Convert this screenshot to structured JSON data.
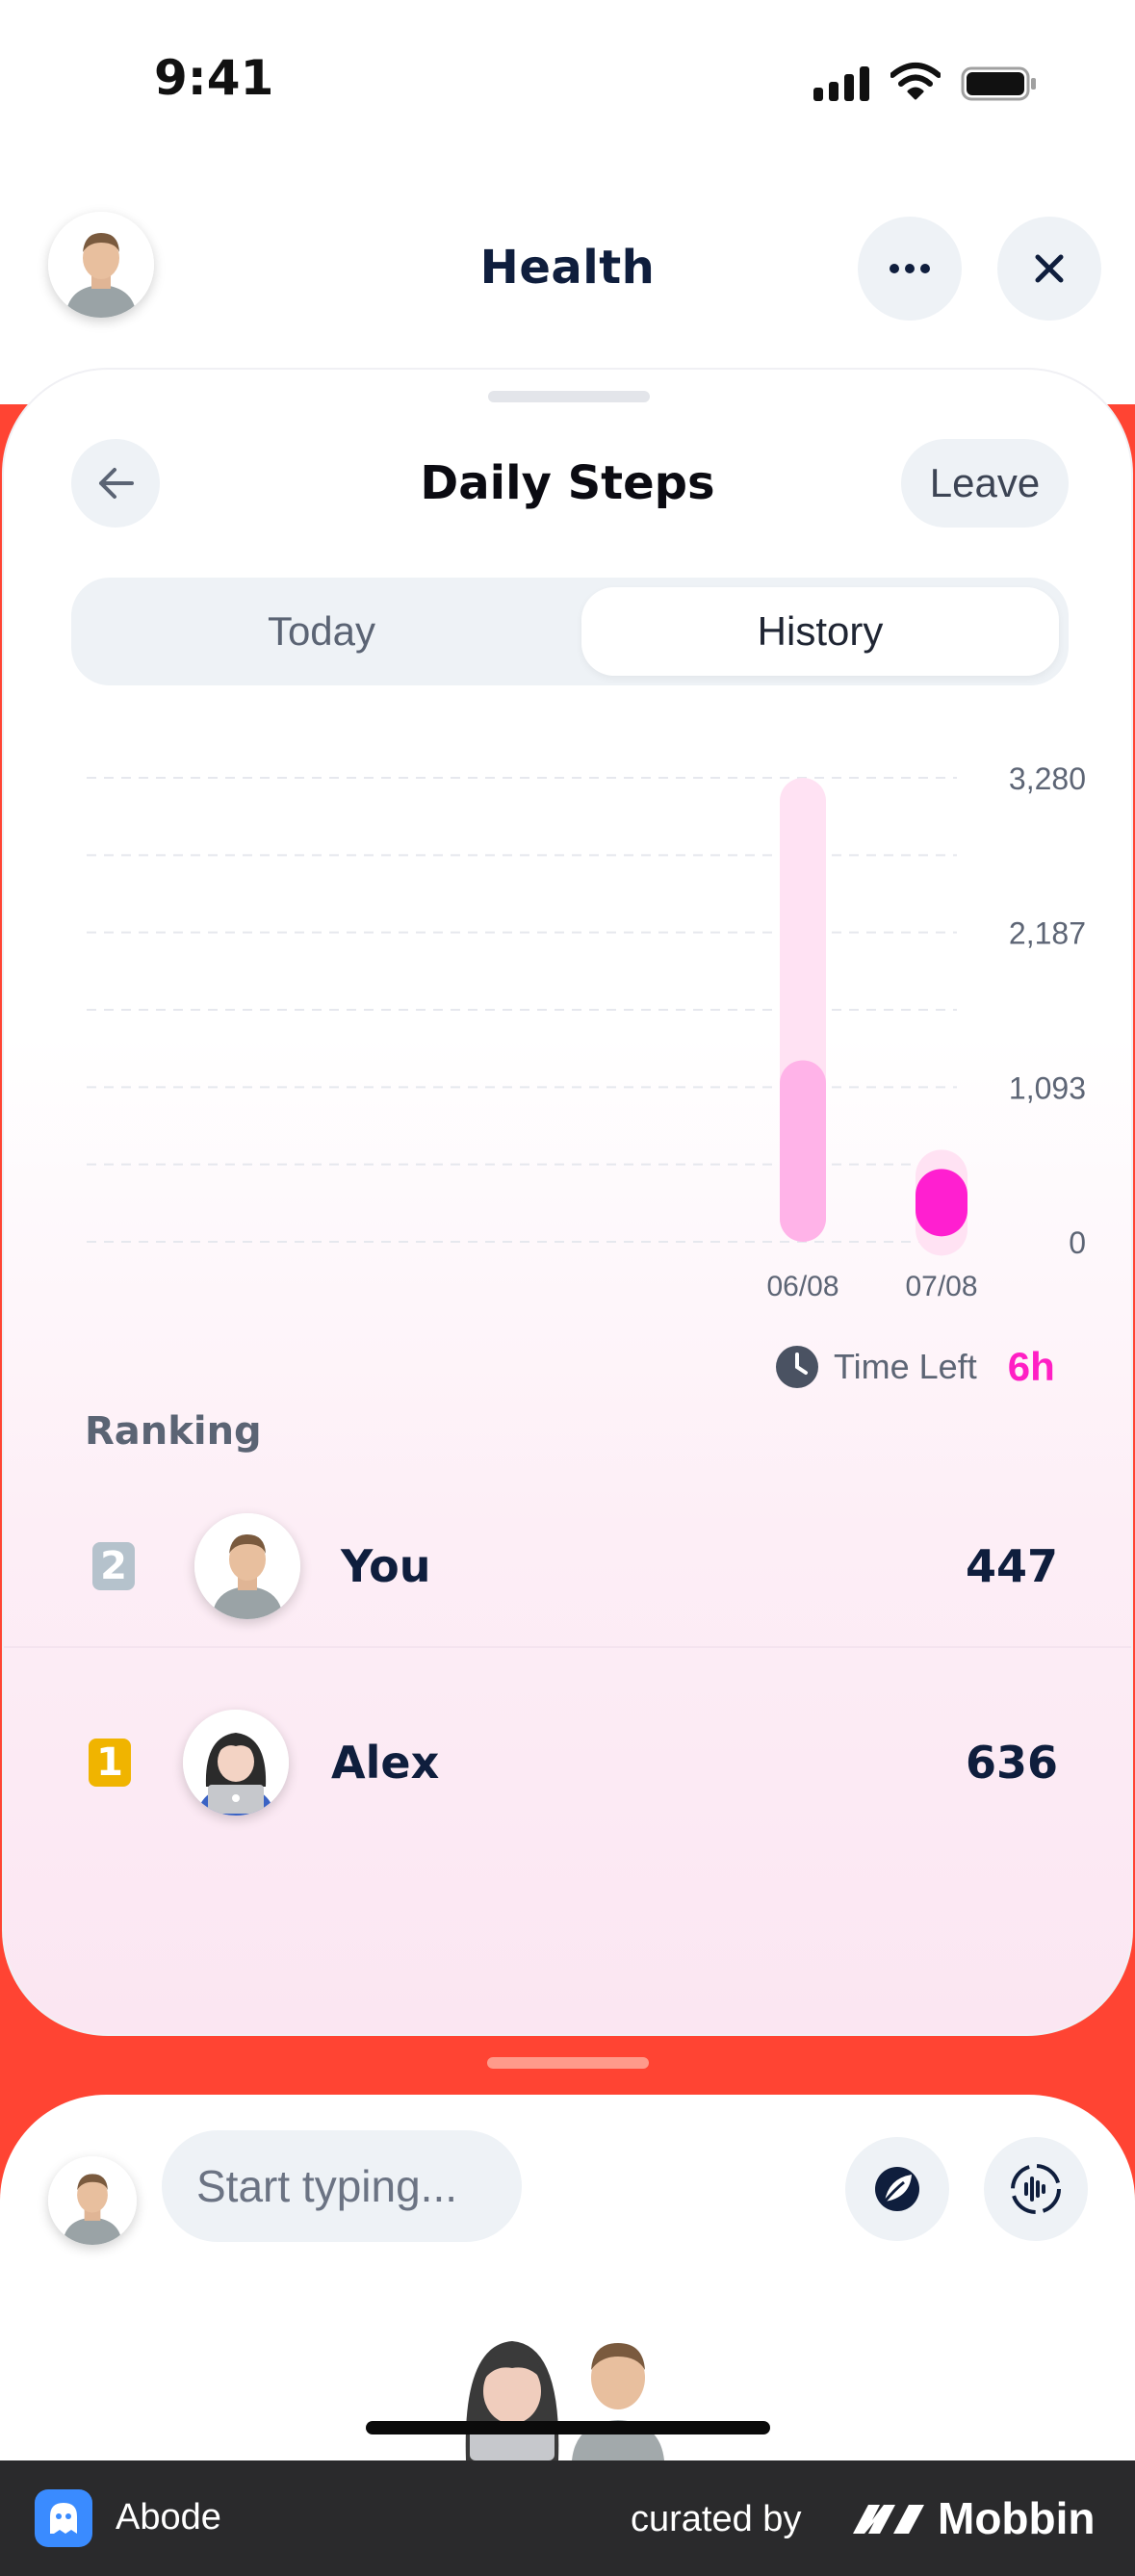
{
  "status_bar": {
    "time": "9:41"
  },
  "header": {
    "title": "Health"
  },
  "card": {
    "title": "Daily Steps",
    "leave_label": "Leave",
    "tabs": [
      {
        "label": "Today",
        "selected": false
      },
      {
        "label": "History",
        "selected": true
      }
    ]
  },
  "chart_data": {
    "type": "bar",
    "categories": [
      "06/08",
      "07/08"
    ],
    "series": [
      {
        "values": [
          3280,
          447
        ]
      },
      {
        "values": [
          1283,
          447
        ]
      }
    ],
    "y_ticks": [
      "3,280",
      "2,187",
      "1,093",
      "0"
    ],
    "ylim": [
      0,
      3280
    ],
    "grid": true,
    "colors": {
      "track": "#ffe2f3",
      "fill": "#ffb3e8",
      "today": "#ff1fd0"
    }
  },
  "time_left": {
    "label": "Time Left",
    "value": "6h"
  },
  "ranking": {
    "title": "Ranking",
    "rows": [
      {
        "rank": "2",
        "name": "You",
        "value": "447",
        "avatar": "male-avatar"
      },
      {
        "rank": "1",
        "name": "Alex",
        "value": "636",
        "avatar": "female-avatar"
      }
    ]
  },
  "composer": {
    "placeholder": "Start typing..."
  },
  "footer": {
    "app_name": "Abode",
    "curated_by": "curated by",
    "brand": "Mobbin"
  },
  "colors": {
    "accent": "#ff1fc4",
    "background_red": "#ff4433",
    "navy": "#0f1e3d"
  }
}
